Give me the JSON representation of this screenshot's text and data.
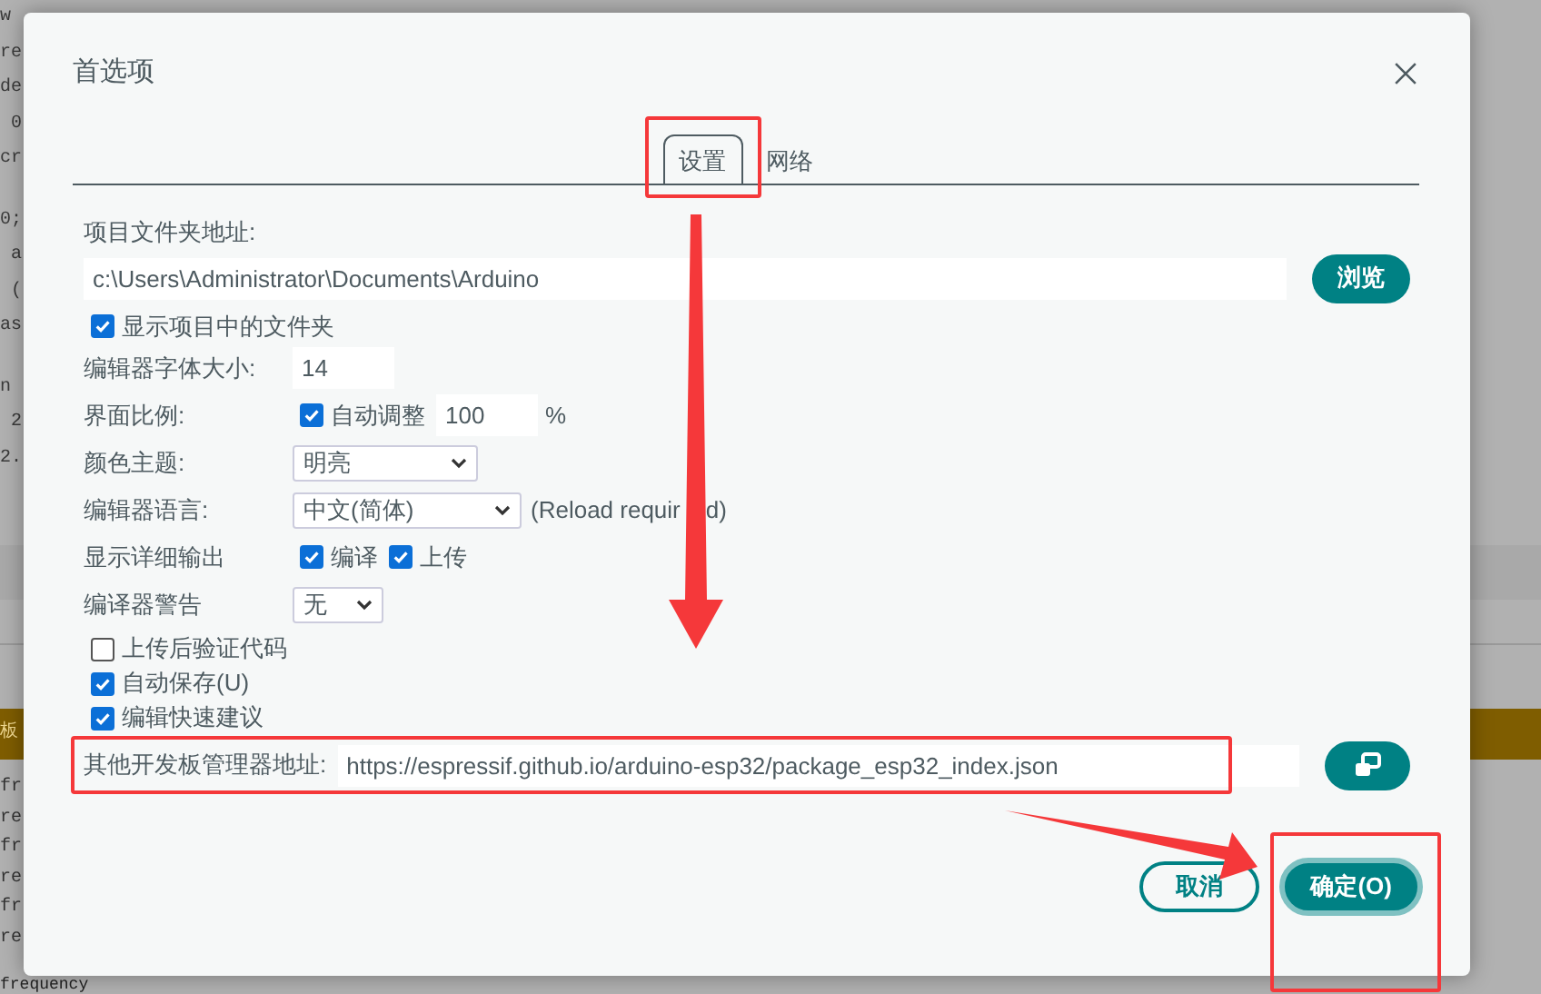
{
  "background": {
    "code_lines": [
      "w",
      "re",
      "de",
      " 0",
      "cr",
      "0;",
      " a",
      " (",
      "as",
      "n",
      " 2",
      "2."
    ],
    "status_text": "板",
    "output_lines": [
      "fr",
      "re",
      "fr",
      "re",
      "fr",
      "re",
      "frequency"
    ]
  },
  "dialog": {
    "title": "首选项",
    "tabs": [
      {
        "label": "设置",
        "selected": true,
        "highlighted": true
      },
      {
        "label": "网络",
        "selected": false,
        "highlighted": false
      }
    ],
    "sketchbook": {
      "label": "项目文件夹地址:",
      "value": "c:\\Users\\Administrator\\Documents\\Arduino",
      "button": "浏览"
    },
    "show_files": {
      "label": "显示项目中的文件夹",
      "checked": true
    },
    "settings": [
      {
        "kind": "number",
        "label": "编辑器字体大小:",
        "value": "14"
      },
      {
        "kind": "scale",
        "label": "界面比例:",
        "check_label": "自动调整",
        "checked": true,
        "value": "100",
        "unit": "%"
      },
      {
        "kind": "select",
        "label": "颜色主题:",
        "value": "明亮"
      },
      {
        "kind": "select",
        "label": "编辑器语言:",
        "value": "中文(简体)",
        "note": "(Reload requir",
        "note_tail": "d)"
      },
      {
        "kind": "checks",
        "label": "显示详细输出",
        "options": [
          {
            "label": "编译",
            "checked": true
          },
          {
            "label": "上传",
            "checked": true
          }
        ]
      },
      {
        "kind": "select",
        "label": "编译器警告",
        "value": "无"
      }
    ],
    "options": [
      {
        "label": "上传后验证代码",
        "checked": false
      },
      {
        "label": "自动保存(U)",
        "checked": true
      },
      {
        "label": "编辑快速建议",
        "checked": true
      }
    ],
    "board_urls": {
      "label": "其他开发板管理器地址:",
      "value": "https://espressif.github.io/arduino-esp32/package_esp32_index.json",
      "highlighted": true
    },
    "buttons": [
      {
        "label": "取消",
        "kind": "secondary",
        "highlighted": false
      },
      {
        "label": "确定(O)",
        "kind": "primary",
        "highlighted": true
      }
    ]
  }
}
